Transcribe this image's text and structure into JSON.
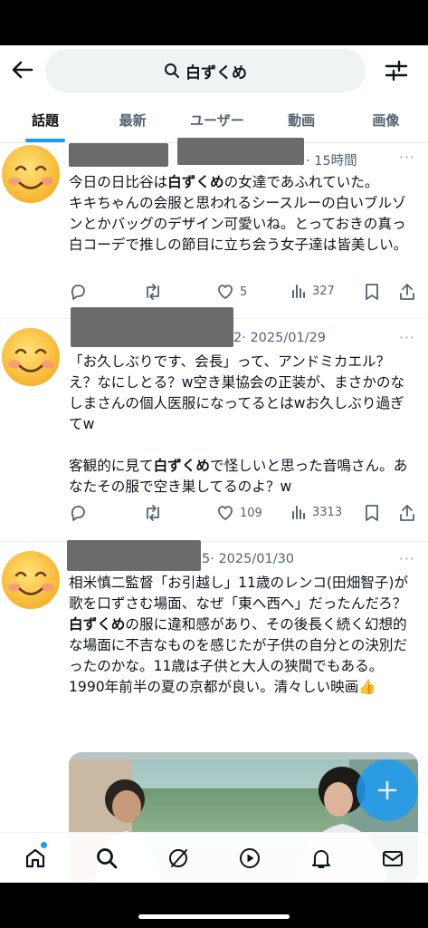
{
  "search": {
    "query": "白ずくめ"
  },
  "tabs": [
    {
      "label": "話題"
    },
    {
      "label": "最新"
    },
    {
      "label": "ユーザー"
    },
    {
      "label": "動画"
    },
    {
      "label": "画像"
    }
  ],
  "posts": [
    {
      "time": "· 15時間",
      "text_before": "今日の日比谷は",
      "highlight": "白ずくめ",
      "text_after": "の女達であふれていた。\nキキちゃんの会服と思われるシースルーの白いブルゾンとかバッグのデザイン可愛いね。とっておきの真っ白コーデで推しの節目に立ち会う女子達は皆美しい。",
      "likes": "5",
      "views": "327"
    },
    {
      "time_prefix": "2",
      "time": "· 2025/01/29",
      "text_before": "「お久しぶりです、会長」って、アンドミカエル？え？なにしとる？w空き巣協会の正装が、まさかのなしまさんの個人医服になってるとはwお久しぶり過ぎてw\n\n客観的に見て",
      "highlight": "白ずくめ",
      "text_after": "で怪しいと思った音鳴さん。あなたその服で空き巣してるのよ？w",
      "likes": "109",
      "views": "3313"
    },
    {
      "time_prefix": "5",
      "time": "· 2025/01/30",
      "text_before": "相米慎二監督「お引越し」11歳のレンコ(田畑智子)が歌を口ずさむ場面、なぜ「東へ西へ」だったんだろ？\n",
      "highlight": "白ずくめ",
      "text_after": "の服に違和感があり、その後長く続く幻想的な場面に不吉なものを感じたが子供の自分との決別だったのかな。11歳は子供と大人の狭間でもある。\n1990年前半の夏の京都が良い。清々しい映画",
      "emoji": "👍"
    }
  ],
  "colors": {
    "accent": "#1d9bf0",
    "text": "#0f1419",
    "muted": "#536471"
  }
}
